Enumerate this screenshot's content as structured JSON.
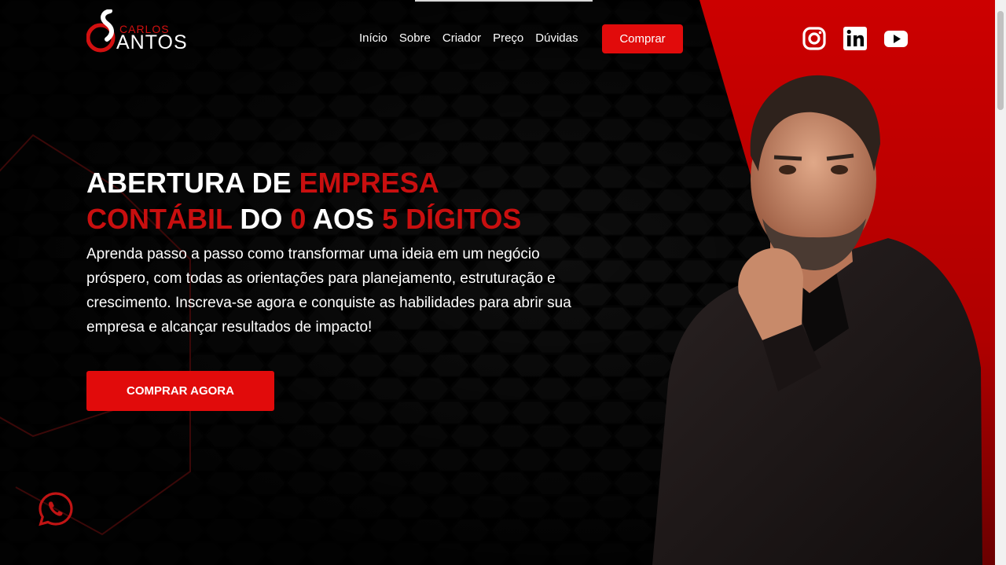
{
  "header": {
    "logo": {
      "small_text": "CARLOS",
      "big_text": "ANTOS"
    },
    "nav": [
      "Início",
      "Sobre",
      "Criador",
      "Preço",
      "Dúvidas"
    ],
    "buy_label": "Comprar",
    "social": [
      "instagram-icon",
      "linkedin-icon",
      "youtube-icon"
    ]
  },
  "hero": {
    "headline": {
      "w1": "ABERTURA DE ",
      "r1": "EMPRESA",
      "r2": "CONTÁBIL",
      "w2": " DO ",
      "r3": "0",
      "w3": " AOS ",
      "r4": "5 DÍGITOS"
    },
    "description": "Aprenda passo a passo como transformar uma ideia em um negócio próspero, com todas as orientações para planejamento, estruturação e crescimento. Inscreva-se agora e conquiste as habilidades para abrir sua empresa e alcançar resultados de impacto!",
    "cta_label": "COMPRAR AGORA"
  },
  "colors": {
    "accent": "#e10b0b",
    "background": "#000000",
    "headline_red": "#c80f0f"
  }
}
